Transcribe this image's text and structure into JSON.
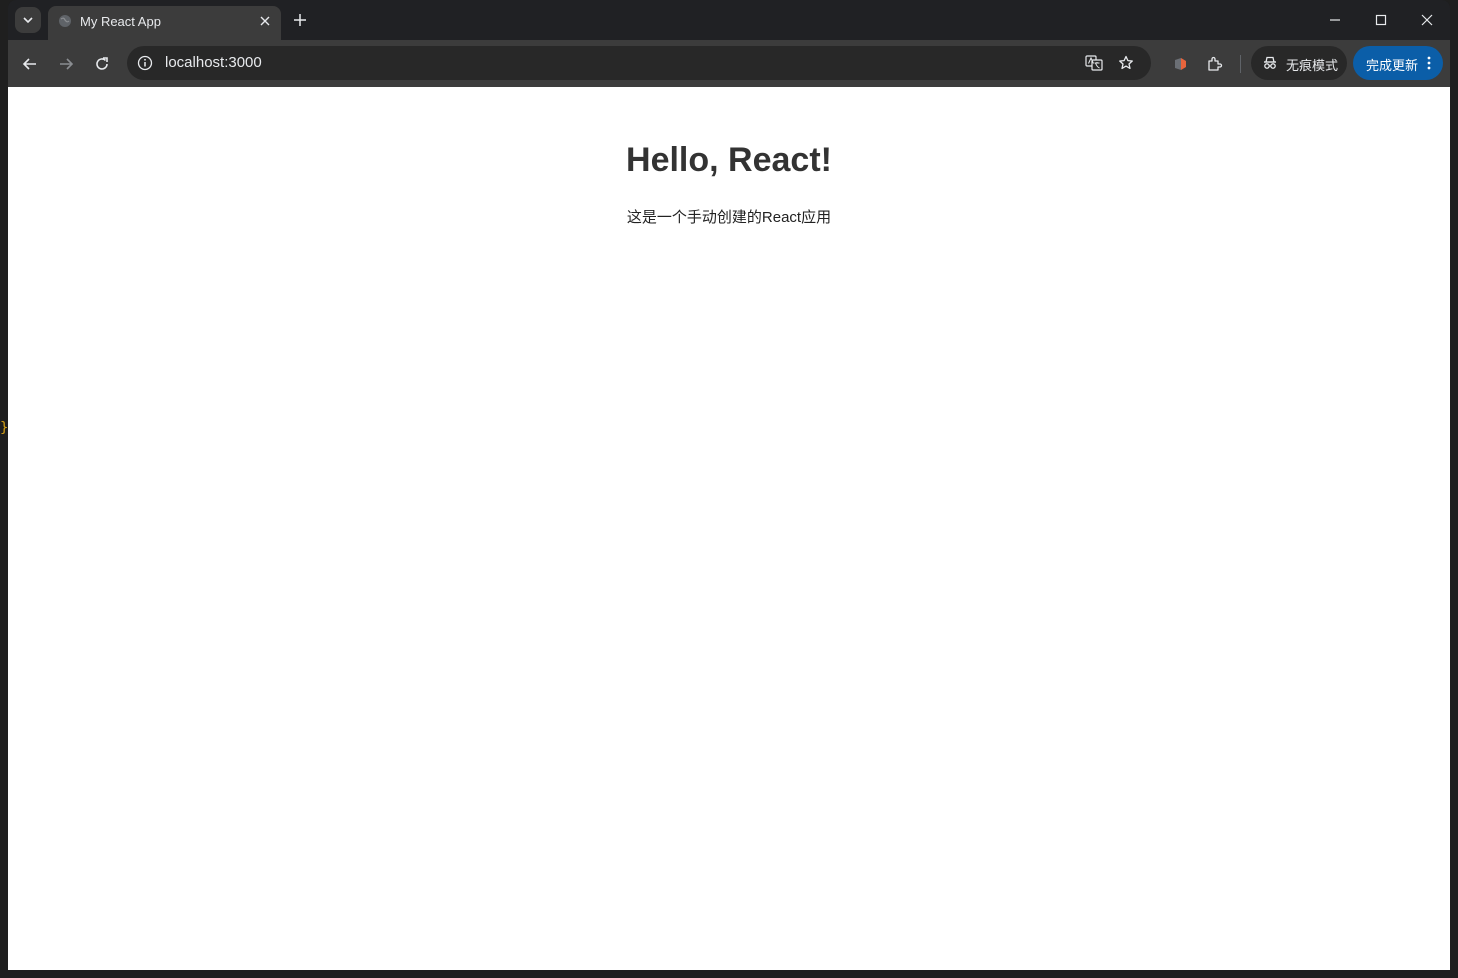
{
  "browser": {
    "tab": {
      "title": "My React App",
      "favicon": "globe-icon"
    },
    "address_bar": {
      "url": "localhost:3000"
    },
    "incognito_label": "无痕模式",
    "update_label": "完成更新",
    "colors": {
      "titlebar": "#202124",
      "toolbar": "#3c3c3c",
      "omnibox": "#282828",
      "update_button": "#0b5ea8"
    }
  },
  "page": {
    "heading": "Hello, React!",
    "text": "这是一个手动创建的React应用"
  },
  "edge_glyph": "}"
}
